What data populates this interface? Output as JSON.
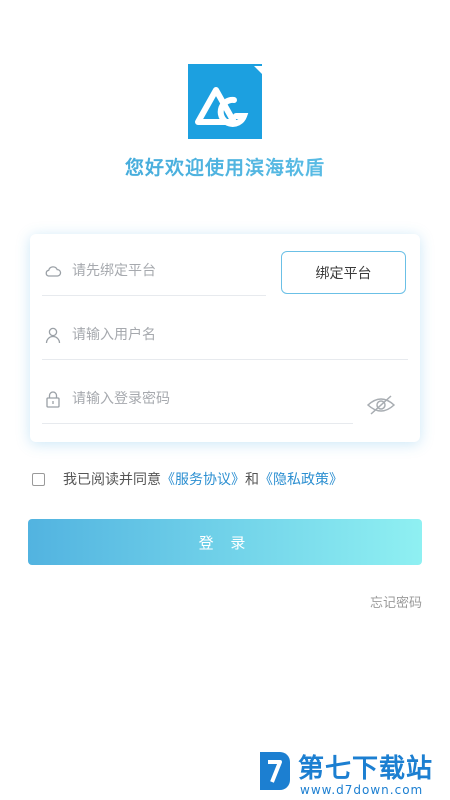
{
  "header": {
    "welcome": "您好欢迎使用滨海软盾"
  },
  "form": {
    "platform": {
      "placeholder": "请先绑定平台",
      "icon": "cloud-icon"
    },
    "bind_button": "绑定平台",
    "username": {
      "placeholder": "请输入用户名",
      "icon": "user-icon"
    },
    "password": {
      "placeholder": "请输入登录密码",
      "icon": "lock-icon",
      "toggle_icon": "eye-hidden-icon"
    }
  },
  "agreement": {
    "prefix": "我已阅读并同意",
    "service_link": "《服务协议》",
    "and": "和",
    "privacy_link": "《隐私政策》",
    "checked": false
  },
  "login_button": "登 录",
  "forgot_password": "忘记密码",
  "watermark": {
    "title": "第七下载站",
    "url": "www.d7down.com"
  },
  "colors": {
    "accent": "#52b3e0",
    "accent_light": "#8ff0f2",
    "link": "#2c8fd1",
    "brand_blue": "#1ca0e0"
  }
}
